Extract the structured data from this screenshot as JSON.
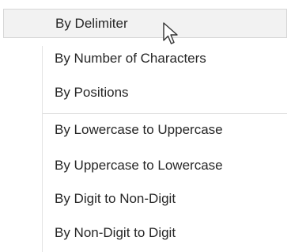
{
  "menu": {
    "items": [
      {
        "label": "By Delimiter"
      },
      {
        "label": "By Number of Characters"
      },
      {
        "label": "By Positions"
      },
      {
        "label": "By Lowercase to Uppercase"
      },
      {
        "label": "By Uppercase to Lowercase"
      },
      {
        "label": "By Digit to Non-Digit"
      },
      {
        "label": "By Non-Digit to Digit"
      }
    ]
  },
  "colors": {
    "hover_background": "#f2f2f2",
    "hover_border": "#d6d6d6",
    "text": "#262626"
  },
  "icons": {
    "cursor": "mouse-pointer-icon"
  }
}
